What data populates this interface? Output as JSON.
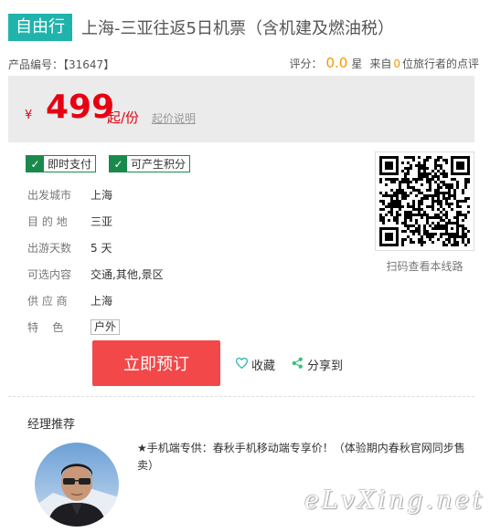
{
  "header": {
    "tag": "自由行",
    "title": "上海-三亚往返5日机票（含机建及燃油税）"
  },
  "meta": {
    "code_label": "产品编号：",
    "code_value": "【31647】",
    "score_label": "评分：",
    "score_value": "0.0",
    "score_unit": "星",
    "from_label": "来自",
    "traveler_count": "0",
    "review_suffix": "位旅行者的点评"
  },
  "price": {
    "currency": "¥",
    "value": "499",
    "unit": "起/份",
    "explain_link": "起价说明"
  },
  "badges": [
    "即时支付",
    "可产生积分"
  ],
  "info": [
    {
      "key": "出发城市",
      "value": "上海"
    },
    {
      "key": "目 的 地",
      "value": "三亚"
    },
    {
      "key": "出游天数",
      "value": "5 天"
    },
    {
      "key": "可选内容",
      "value": "交通,其他,景区"
    },
    {
      "key": "供 应 商",
      "value": "上海"
    },
    {
      "key": "特    色",
      "value": "户外"
    }
  ],
  "qr": {
    "caption": "扫码查看本线路"
  },
  "actions": {
    "book": "立即预订",
    "favorite": "收藏",
    "share": "分享到"
  },
  "manager": {
    "title": "经理推荐",
    "text": "★手机端专供：春秋手机移动端专享价！（体验期内春秋官网同步售卖）"
  },
  "watermark": "eLvXing.net",
  "colors": {
    "accent_teal": "#20b3ac",
    "price_red": "#e60012",
    "book_button": "#f24849",
    "badge_green": "#1a8a4c",
    "score_orange": "#f39800"
  }
}
